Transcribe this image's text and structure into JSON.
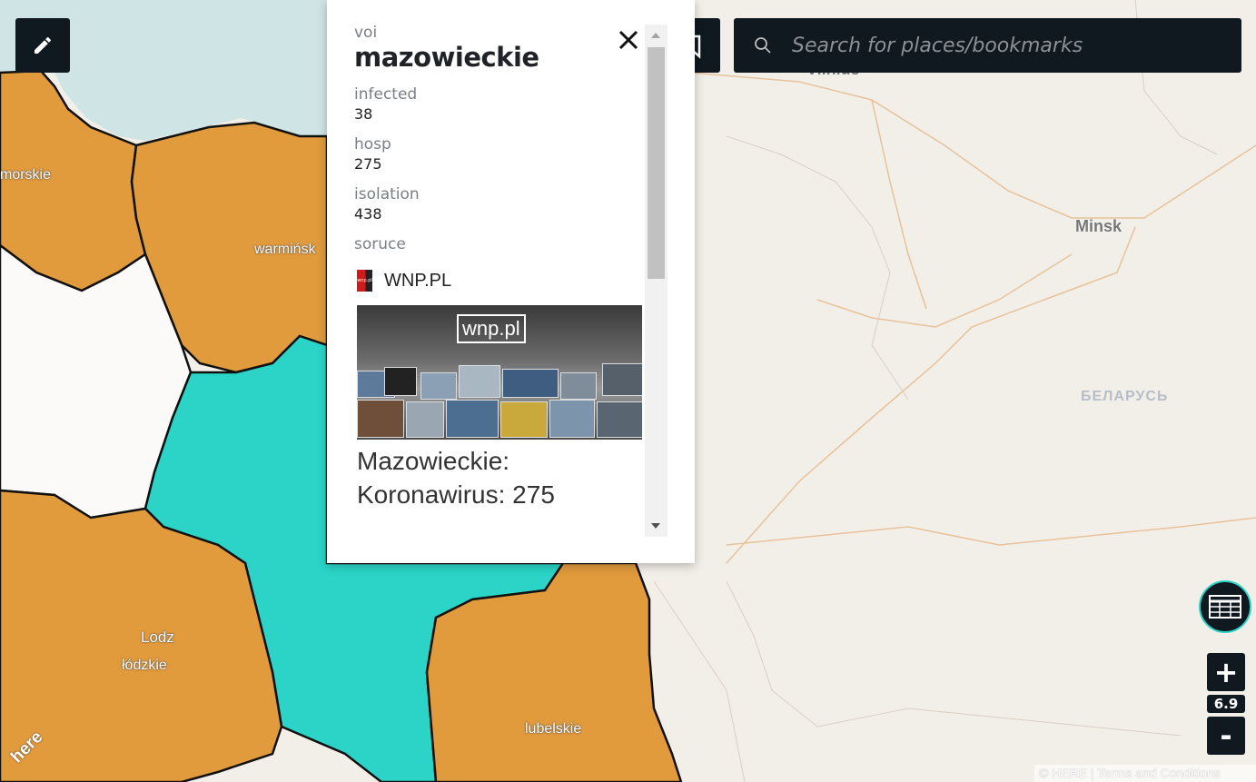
{
  "colors": {
    "region_default": "#e19a3c",
    "region_selected": "#2bd4c7",
    "region_none": "#fbfaf8",
    "water": "#cfe4e4",
    "land": "#f2efe9",
    "border": "#111111",
    "toolbar": "#101820"
  },
  "search": {
    "placeholder": "Search for places/bookmarks"
  },
  "toolbar": {
    "edit_icon": "pencil-icon",
    "bookmark_icon": "bookmark-icon",
    "search_icon": "search-icon"
  },
  "popup": {
    "field1_label": "voi",
    "region": "mazowieckie",
    "field2_label": "infected",
    "field2_value": "38",
    "field3_label": "hosp",
    "field3_value": "275",
    "field4_label": "isolation",
    "field4_value": "438",
    "field5_label": "soruce",
    "source_name": "WNP.PL",
    "favicon_text": "wnp.pl",
    "thumbnail_logo": "wnp.pl",
    "article_title": "Mazowieckie: Koronawirus: 275"
  },
  "map_labels": {
    "pomorskie": "morskie",
    "warminsko": "warmińsk",
    "lodz_city": "Lodz",
    "lodzkie": "łódzkie",
    "lubelskie": "lubelskie",
    "vilnius": "Vilnius",
    "minsk": "Minsk",
    "belarus": "БЕЛАРУСЬ"
  },
  "zoom": {
    "level": "6.9",
    "in_label": "+",
    "out_label": "-"
  },
  "attribution": {
    "copyright": "© HERE",
    "terms": "Terms and Conditions"
  },
  "brand": {
    "logo": "here"
  }
}
